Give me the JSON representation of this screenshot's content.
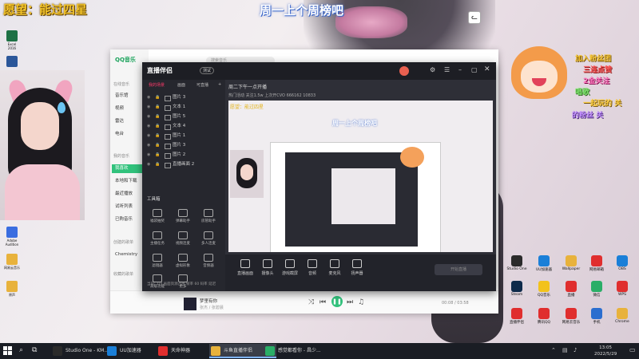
{
  "overlay": {
    "banner": "愿望：能过四星",
    "weekly": "周一上个周榜吧",
    "right_lines": [
      "加入粉丝团",
      "三连点赞",
      "2金关注",
      "唱歌",
      "一起玩的 关",
      "的粉丝 关"
    ]
  },
  "desktop_left": [
    {
      "label": "Excel 2016",
      "color": "#1e7145"
    },
    {
      "label": "Word 2016",
      "color": "#2b579a"
    },
    {
      "label": "Adobe Audition",
      "color": "#3a6de0"
    },
    {
      "label": "网易云音乐",
      "color": "#e8b23c"
    },
    {
      "label": "原声",
      "color": "#e8b23c"
    }
  ],
  "qq": {
    "logo": "QQ音乐",
    "search_placeholder": "搜索音乐",
    "section1": "在线音乐",
    "online": [
      "音乐馆",
      "视频",
      "雷达",
      "电台"
    ],
    "section2": "我的音乐",
    "mine": [
      "我喜欢",
      "本地和下载",
      "最近播放",
      "试听列表",
      "已购音乐"
    ],
    "section3": "创建的歌单",
    "created": [
      "Chemistry"
    ],
    "section4": "收藏的歌单",
    "song": "梦里有你",
    "artist": "张杰 / 张碧晨",
    "time": "00:08 / 03:58"
  },
  "zb": {
    "logo": "直播伴侣",
    "beta": "测试",
    "tabs": [
      "我的场景",
      "画面",
      "可直播"
    ],
    "sources": [
      "图片 3",
      "文本 1",
      "图片 5",
      "文本 4",
      "图片 1",
      "图片 3",
      "图片 2",
      "直播画面 2"
    ],
    "tools_title": "工具箱",
    "tools": [
      "福袋抽奖",
      "弹幕助手",
      "房管助手",
      "主播任务",
      "视频连麦",
      "多人连麦",
      "滤镜器",
      "虚拟形象",
      "音频器",
      "高级功能",
      "更多",
      ""
    ],
    "title": "周二下午一点开播",
    "stats": "热门活动   关注1.5w   上次开CVO   666162   10833",
    "bottom_buttons": [
      "直播画面",
      "摄像头",
      "游戏截屏",
      "音频",
      "麦克风",
      "扬声器"
    ],
    "start_live": "开始直播",
    "status": "当前: 1/4    画面资源占用    帧率 60   码率   延迟"
  },
  "desktop_right": [
    {
      "label": "Studio One",
      "color": "#2b2b2b"
    },
    {
      "label": "UU加速器",
      "color": "#1a7fd8"
    },
    {
      "label": "Wallpaper",
      "color": "#e8b23c"
    },
    {
      "label": "网易邮箱",
      "color": "#e02e2e"
    },
    {
      "label": "OBS",
      "color": "#1a7fd8"
    },
    {
      "label": "Steam",
      "color": "#0e2a4a"
    },
    {
      "label": "QQ音乐",
      "color": "#f2c21b"
    },
    {
      "label": "直播",
      "color": "#e02e2e"
    },
    {
      "label": "微信",
      "color": "#2aae67"
    },
    {
      "label": "WPS",
      "color": "#e02e2e"
    },
    {
      "label": "直播伴侣",
      "color": "#e02e2e"
    },
    {
      "label": "腾讯QQ",
      "color": "#e02e2e"
    },
    {
      "label": "网易云音乐",
      "color": "#e02e2e"
    },
    {
      "label": "手机",
      "color": "#2b6ecf"
    },
    {
      "label": "Chrome",
      "color": "#e8b23c"
    }
  ],
  "taskbar": {
    "tasks": [
      {
        "label": "Studio One - KM...",
        "color": "#2b2b2b"
      },
      {
        "label": "UU加速器",
        "color": "#1a7fd8"
      },
      {
        "label": "天命神器",
        "color": "#e02e2e"
      },
      {
        "label": "斗鱼直播伴侣",
        "color": "#e8b23c"
      },
      {
        "label": "感觉都看你 - 昌少...",
        "color": "#2aae67"
      }
    ],
    "time": "13:05",
    "date": "2022/5/29"
  }
}
